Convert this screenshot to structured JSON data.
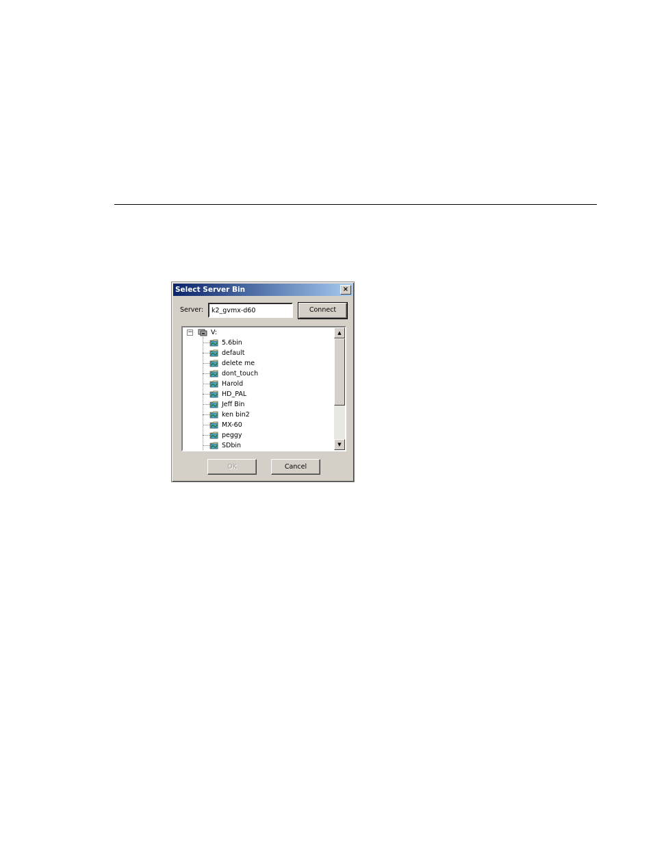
{
  "dialog": {
    "title": "Select Server Bin",
    "close_glyph": "×",
    "server_label": "Server:",
    "server_value": "k2_gvmx-d60",
    "connect_label": "Connect",
    "ok_label": "OK",
    "cancel_label": "Cancel"
  },
  "tree": {
    "root": {
      "label": "V:",
      "expander": "−",
      "icon": "drive-icon"
    },
    "items": [
      {
        "label": "5.6bin",
        "icon": "bin-icon"
      },
      {
        "label": "default",
        "icon": "bin-icon"
      },
      {
        "label": "delete me",
        "icon": "bin-icon"
      },
      {
        "label": "dont_touch",
        "icon": "bin-icon"
      },
      {
        "label": "Harold",
        "icon": "bin-icon"
      },
      {
        "label": "HD_PAL",
        "icon": "bin-icon"
      },
      {
        "label": "Jeff Bin",
        "icon": "bin-icon"
      },
      {
        "label": "ken bin2",
        "icon": "bin-icon"
      },
      {
        "label": "MX-60",
        "icon": "bin-icon"
      },
      {
        "label": "peggy",
        "icon": "bin-icon"
      },
      {
        "label": "SDbin",
        "icon": "bin-icon"
      }
    ]
  },
  "scrollbar": {
    "up_glyph": "▲",
    "down_glyph": "▼"
  },
  "colors": {
    "title_start": "#0a246a",
    "title_end": "#a6caf0",
    "face": "#d4d0c8"
  }
}
